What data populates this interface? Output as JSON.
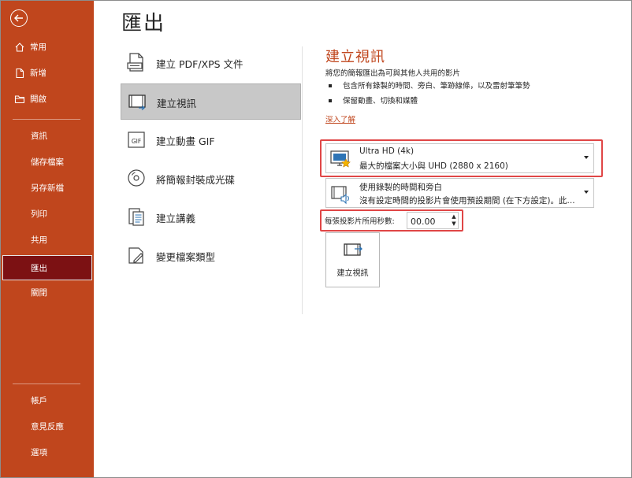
{
  "sidebar": {
    "nav_top": [
      {
        "label": "常用",
        "icon": "home-icon"
      },
      {
        "label": "新增",
        "icon": "new-file-icon"
      },
      {
        "label": "開啟",
        "icon": "open-folder-icon"
      }
    ],
    "nav_mid": [
      {
        "label": "資訊"
      },
      {
        "label": "儲存檔案"
      },
      {
        "label": "另存新檔"
      },
      {
        "label": "列印"
      },
      {
        "label": "共用"
      },
      {
        "label": "匯出",
        "active": true
      },
      {
        "label": "關閉"
      }
    ],
    "nav_bottom": [
      {
        "label": "帳戶"
      },
      {
        "label": "意見反應"
      },
      {
        "label": "選項"
      }
    ]
  },
  "page_title": "匯出",
  "export_options": [
    {
      "label": "建立 PDF/XPS 文件",
      "icon": "pdf-document-icon"
    },
    {
      "label": "建立視訊",
      "icon": "video-icon",
      "selected": true
    },
    {
      "label": "建立動畫 GIF",
      "icon": "gif-icon"
    },
    {
      "label": "將簡報封裝成光碟",
      "icon": "cd-icon"
    },
    {
      "label": "建立講義",
      "icon": "handout-icon"
    },
    {
      "label": "變更檔案類型",
      "icon": "change-file-type-icon"
    }
  ],
  "video": {
    "title": "建立視訊",
    "description": "將您的簡報匯出為可與其他人共用的影片",
    "bullets": [
      "包含所有錄製的時間、旁白、筆跡線條，以及雷射筆筆勢",
      "保留動畫、切換和媒體"
    ],
    "learn_more": "深入了解",
    "quality": {
      "line1": "Ultra HD (4k)",
      "line2": "最大的檔案大小與 UHD (2880 x 2160)"
    },
    "timings": {
      "line1": "使用錄製的時間和旁白",
      "line2": "沒有設定時間的投影片會使用預設期間 (在下方設定)。此..."
    },
    "seconds_label": "每張投影片所用秒數:",
    "seconds_value": "00.00",
    "create_button": "建立視訊"
  },
  "colors": {
    "sidebar": "#c0461d",
    "active_item": "#7c1113",
    "accent_text": "#c0461d",
    "highlight": "#e04646"
  }
}
